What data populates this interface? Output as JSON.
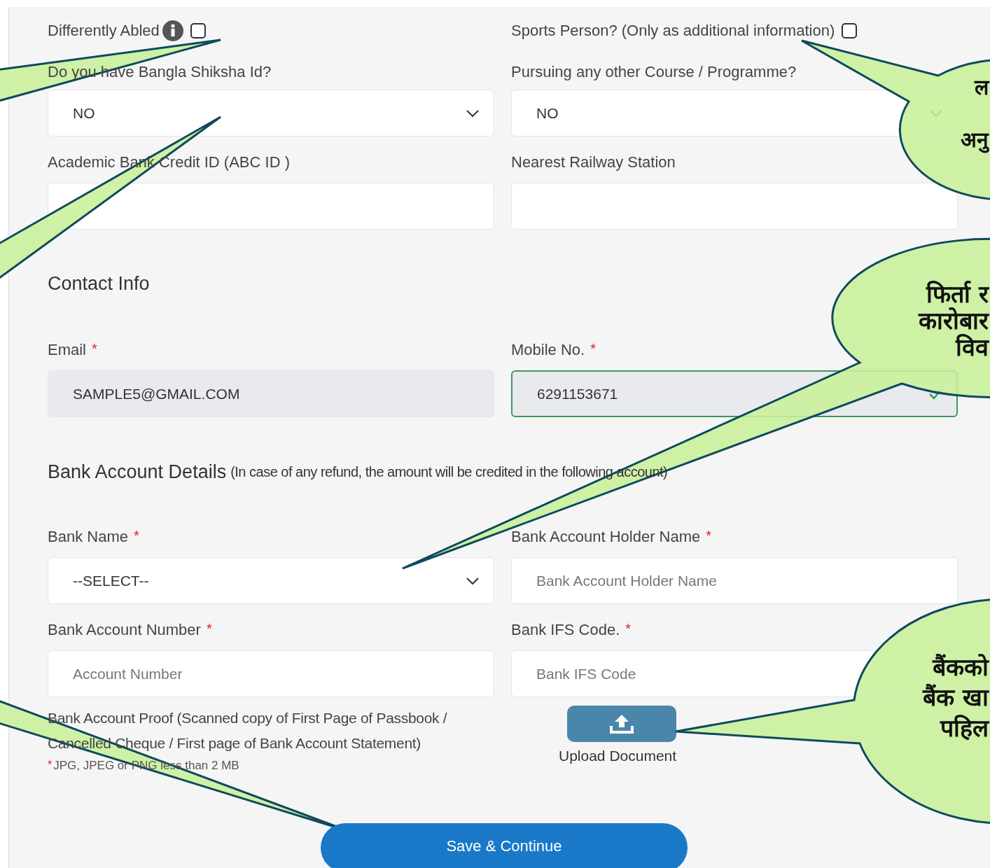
{
  "checkboxes": [
    {
      "label": "Differently Abled",
      "info": true,
      "checked": false
    },
    {
      "label": "Sports Person? (Only as additional information)",
      "info": false,
      "checked": false
    }
  ],
  "top_rows": [
    [
      {
        "label": "Do you have Bangla Shiksha Id?",
        "kind": "select",
        "value": "NO"
      },
      {
        "label": "Pursuing any other Course / Programme?",
        "kind": "select",
        "value": "NO"
      }
    ],
    [
      {
        "label": "Academic Bank Credit ID (ABC ID )",
        "kind": "input"
      },
      {
        "label": "Nearest Railway Station",
        "kind": "input"
      }
    ]
  ],
  "contact": {
    "title": "Contact Info",
    "rows": [
      [
        {
          "label": "Email",
          "required": "*",
          "kind": "readonly",
          "value": "SAMPLE5@GMAIL.COM"
        },
        {
          "label": "Mobile No.",
          "required": "*",
          "kind": "valid",
          "value": "6291153671"
        }
      ]
    ]
  },
  "bank": {
    "title": "Bank Account Details",
    "note": "(In case of any refund, the amount will be credited in the following account)",
    "rows": [
      [
        {
          "label": "Bank Name",
          "required": "*",
          "kind": "select",
          "value": "--SELECT--"
        },
        {
          "label": "Bank Account Holder Name",
          "required": "*",
          "kind": "input",
          "placeholder": "Bank Account Holder Name"
        }
      ],
      [
        {
          "label": "Bank Account Number",
          "required": "*",
          "kind": "input",
          "placeholder": "Account Number"
        },
        {
          "label": "Bank IFS Code.",
          "required": "*",
          "kind": "input",
          "placeholder": "Bank IFS Code"
        }
      ]
    ],
    "proof": {
      "label": "Bank Account Proof (Scanned copy of First Page of Passbook / Cancelled Cheque / First page of Bank Account Statement)",
      "required": "*",
      "note": "JPG, JPEG or PNG less than 2 MB",
      "upload_label": "Upload Document"
    }
  },
  "submit": "Save & Continue",
  "callouts": [
    {
      "lines": [
        "ल",
        "अनु"
      ]
    },
    {
      "lines": [
        "फिर्ता र",
        "कारोबार",
        "विव"
      ]
    },
    {
      "lines": [
        "बैंकको",
        "बैंक खा",
        "पहिल"
      ]
    }
  ]
}
